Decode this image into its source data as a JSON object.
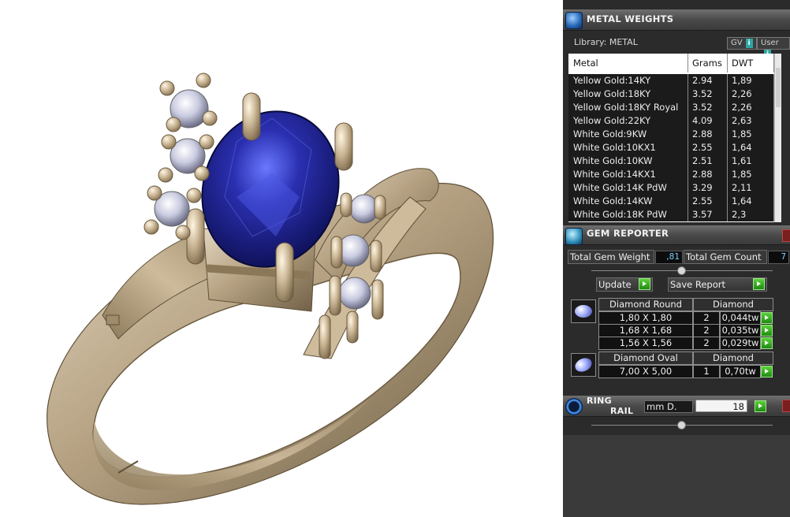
{
  "metal_weights": {
    "title": "METAL WEIGHTS",
    "library": "Library: METAL",
    "gv_label": "GV",
    "user_label": "User",
    "info_icon_text": "i",
    "columns": [
      "Metal",
      "Grams",
      "DWT"
    ],
    "rows": [
      {
        "metal": "Yellow Gold:14KY",
        "grams": "2.94",
        "dwt": "1,89"
      },
      {
        "metal": "Yellow Gold:18KY",
        "grams": "3.52",
        "dwt": "2,26"
      },
      {
        "metal": "Yellow Gold:18KY Royal",
        "grams": "3.52",
        "dwt": "2,26"
      },
      {
        "metal": "Yellow Gold:22KY",
        "grams": "4.09",
        "dwt": "2,63"
      },
      {
        "metal": "White Gold:9KW",
        "grams": "2.88",
        "dwt": "1,85"
      },
      {
        "metal": "White Gold:10KX1",
        "grams": "2.55",
        "dwt": "1,64"
      },
      {
        "metal": "White Gold:10KW",
        "grams": "2.51",
        "dwt": "1,61"
      },
      {
        "metal": "White Gold:14KX1",
        "grams": "2.88",
        "dwt": "1,85"
      },
      {
        "metal": "White Gold:14K PdW",
        "grams": "3.29",
        "dwt": "2,11"
      },
      {
        "metal": "White Gold:14KW",
        "grams": "2.55",
        "dwt": "1,64"
      },
      {
        "metal": "White Gold:18K PdW",
        "grams": "3.57",
        "dwt": "2,3"
      }
    ]
  },
  "gem_reporter": {
    "title": "GEM REPORTER",
    "total_weight_label": "Total Gem Weight",
    "total_weight_value": ",81",
    "total_count_label": "Total Gem Count",
    "total_count_value": "7",
    "update_label": "Update",
    "save_report_label": "Save Report",
    "groups": [
      {
        "shape": "Diamond Round",
        "material": "Diamond",
        "rows": [
          {
            "size": "1,80 X 1,80",
            "count": "2",
            "weight": "0,044tw"
          },
          {
            "size": "1,68 X 1,68",
            "count": "2",
            "weight": "0,035tw"
          },
          {
            "size": "1,56 X 1,56",
            "count": "2",
            "weight": "0,029tw"
          }
        ]
      },
      {
        "shape": "Diamond Oval",
        "material": "Diamond",
        "rows": [
          {
            "size": "7,00 X 5,00",
            "count": "1",
            "weight": "0,70tw"
          }
        ]
      }
    ]
  },
  "ring_rail": {
    "title_line1": "RING",
    "title_line2": "RAIL",
    "unit_label": "mm D.",
    "value": "18"
  },
  "colors": {
    "metal": "#b9a68a",
    "center_stone": "#1a1f8c",
    "panel_bg": "#2b2b2b",
    "accent_go": "#2fa51c"
  }
}
